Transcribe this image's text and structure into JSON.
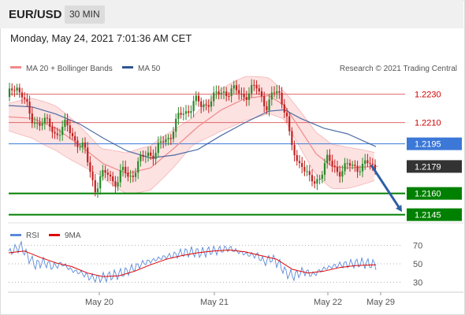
{
  "header": {
    "symbol": "EUR/USD",
    "interval": "30 MIN"
  },
  "datetime": "Monday, May 24, 2021 7:01:36 AM CET",
  "legend": {
    "bb_label": "MA 20 + Bollinger Bands",
    "ma50_label": "MA 50",
    "credit": "Research © 2021 Trading Central",
    "rsi_label": "RSI",
    "rsi_ma_label": "9MA"
  },
  "colors": {
    "bb_line": "#f08a8a",
    "bb_fill": "#fde2e2",
    "ma50": "#2f5597",
    "up_candle": "#2a8a2a",
    "down_candle": "#c22020",
    "resistance": "#e06666",
    "current_line": "#3c78d8",
    "support": "#008000",
    "price_label": "#333333",
    "rsi": "#5b8ad8",
    "rsi_ma": "#e00000",
    "arrow": "#2f5fa8"
  },
  "chart_data": [
    {
      "type": "candlestick",
      "title": "EUR/USD",
      "interval": "30 MIN",
      "ylim": [
        1.2142,
        1.2242
      ],
      "x_ticks": [
        "May 20",
        "May 21",
        "May 22",
        "May 29"
      ],
      "levels": [
        {
          "value": 1.223,
          "label": "1.2230",
          "kind": "resistance"
        },
        {
          "value": 1.221,
          "label": "1.2210",
          "kind": "resistance"
        },
        {
          "value": 1.2195,
          "label": "1.2195",
          "kind": "pivot"
        },
        {
          "value": 1.2179,
          "label": "1.2179",
          "kind": "last_price"
        },
        {
          "value": 1.216,
          "label": "1.2160",
          "kind": "support"
        },
        {
          "value": 1.2145,
          "label": "1.2145",
          "kind": "support"
        }
      ],
      "close_path": [
        [
          0,
          1.2228
        ],
        [
          10,
          1.2236
        ],
        [
          18,
          1.2231
        ],
        [
          28,
          1.221
        ],
        [
          42,
          1.2212
        ],
        [
          58,
          1.2203
        ],
        [
          72,
          1.2207
        ],
        [
          86,
          1.2198
        ],
        [
          96,
          1.219
        ],
        [
          100,
          1.2182
        ],
        [
          104,
          1.2175
        ],
        [
          110,
          1.2164
        ],
        [
          116,
          1.217
        ],
        [
          126,
          1.2174
        ],
        [
          138,
          1.2168
        ],
        [
          146,
          1.2176
        ],
        [
          152,
          1.2172
        ],
        [
          160,
          1.2177
        ],
        [
          170,
          1.2184
        ],
        [
          178,
          1.219
        ],
        [
          186,
          1.2188
        ],
        [
          196,
          1.2196
        ],
        [
          206,
          1.2203
        ],
        [
          216,
          1.2213
        ],
        [
          226,
          1.2219
        ],
        [
          236,
          1.2225
        ],
        [
          244,
          1.2221
        ],
        [
          254,
          1.2226
        ],
        [
          264,
          1.2228
        ],
        [
          274,
          1.2233
        ],
        [
          284,
          1.2232
        ],
        [
          294,
          1.223
        ],
        [
          304,
          1.2231
        ],
        [
          314,
          1.2234
        ],
        [
          322,
          1.2229
        ],
        [
          328,
          1.2221
        ],
        [
          334,
          1.2227
        ],
        [
          342,
          1.2233
        ],
        [
          348,
          1.2224
        ],
        [
          352,
          1.2219
        ],
        [
          356,
          1.22
        ],
        [
          360,
          1.219
        ],
        [
          366,
          1.2182
        ],
        [
          372,
          1.2184
        ],
        [
          380,
          1.217
        ],
        [
          388,
          1.2166
        ],
        [
          396,
          1.2176
        ],
        [
          404,
          1.2183
        ],
        [
          412,
          1.2178
        ],
        [
          420,
          1.2177
        ],
        [
          430,
          1.2178
        ],
        [
          440,
          1.218
        ],
        [
          450,
          1.2179
        ],
        [
          458,
          1.218
        ],
        [
          466,
          1.2179
        ]
      ],
      "ma20_path": [
        [
          0,
          1.2214
        ],
        [
          30,
          1.2213
        ],
        [
          60,
          1.2206
        ],
        [
          90,
          1.2194
        ],
        [
          120,
          1.2181
        ],
        [
          150,
          1.2174
        ],
        [
          180,
          1.2178
        ],
        [
          210,
          1.2192
        ],
        [
          240,
          1.2207
        ],
        [
          270,
          1.2219
        ],
        [
          300,
          1.2227
        ],
        [
          330,
          1.2229
        ],
        [
          350,
          1.2222
        ],
        [
          370,
          1.2205
        ],
        [
          390,
          1.2188
        ],
        [
          410,
          1.2179
        ],
        [
          430,
          1.2178
        ],
        [
          466,
          1.2179
        ]
      ],
      "ma50_path": [
        [
          0,
          1.2222
        ],
        [
          30,
          1.2221
        ],
        [
          60,
          1.2216
        ],
        [
          90,
          1.2209
        ],
        [
          120,
          1.2199
        ],
        [
          150,
          1.219
        ],
        [
          180,
          1.2185
        ],
        [
          210,
          1.2187
        ],
        [
          240,
          1.2191
        ],
        [
          270,
          1.2201
        ],
        [
          300,
          1.221
        ],
        [
          330,
          1.2218
        ],
        [
          350,
          1.2219
        ],
        [
          370,
          1.2213
        ],
        [
          400,
          1.2206
        ],
        [
          430,
          1.2202
        ],
        [
          466,
          1.2193
        ]
      ],
      "bb_width": 0.0013,
      "forecast_arrow": {
        "from": 1.218,
        "to": 1.2147
      }
    },
    {
      "type": "line",
      "title": "RSI",
      "ylim": [
        20,
        80
      ],
      "y_ticks": [
        70,
        50,
        30
      ],
      "series": [
        {
          "name": "RSI",
          "values_path": [
            [
              0,
              62
            ],
            [
              8,
              66
            ],
            [
              16,
              69
            ],
            [
              24,
              58
            ],
            [
              34,
              49
            ],
            [
              44,
              52
            ],
            [
              56,
              47
            ],
            [
              68,
              50
            ],
            [
              80,
              43
            ],
            [
              92,
              40
            ],
            [
              104,
              35
            ],
            [
              114,
              34
            ],
            [
              124,
              36
            ],
            [
              136,
              38
            ],
            [
              148,
              41
            ],
            [
              160,
              46
            ],
            [
              172,
              51
            ],
            [
              184,
              54
            ],
            [
              196,
              57
            ],
            [
              208,
              59
            ],
            [
              220,
              62
            ],
            [
              232,
              63
            ],
            [
              244,
              62
            ],
            [
              256,
              64
            ],
            [
              268,
              65
            ],
            [
              280,
              67
            ],
            [
              292,
              63
            ],
            [
              304,
              60
            ],
            [
              316,
              59
            ],
            [
              324,
              52
            ],
            [
              334,
              56
            ],
            [
              344,
              49
            ],
            [
              352,
              40
            ],
            [
              362,
              37
            ],
            [
              374,
              42
            ],
            [
              386,
              38
            ],
            [
              398,
              44
            ],
            [
              410,
              47
            ],
            [
              422,
              49
            ],
            [
              434,
              50
            ],
            [
              446,
              51
            ],
            [
              458,
              50
            ],
            [
              466,
              49
            ]
          ]
        },
        {
          "name": "9MA",
          "values_path": [
            [
              0,
              62
            ],
            [
              20,
              64
            ],
            [
              40,
              57
            ],
            [
              60,
              51
            ],
            [
              80,
              47
            ],
            [
              100,
              40
            ],
            [
              120,
              36
            ],
            [
              140,
              37
            ],
            [
              160,
              42
            ],
            [
              180,
              49
            ],
            [
              200,
              55
            ],
            [
              220,
              59
            ],
            [
              240,
              62
            ],
            [
              260,
              64
            ],
            [
              280,
              65
            ],
            [
              300,
              63
            ],
            [
              320,
              59
            ],
            [
              340,
              55
            ],
            [
              360,
              44
            ],
            [
              380,
              40
            ],
            [
              400,
              42
            ],
            [
              420,
              46
            ],
            [
              440,
              48
            ],
            [
              466,
              49
            ]
          ]
        }
      ]
    }
  ]
}
